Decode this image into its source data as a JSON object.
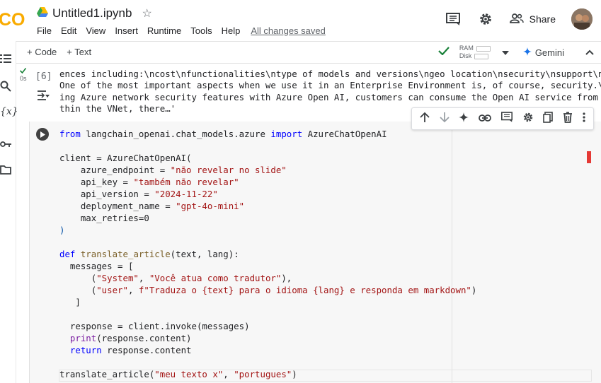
{
  "notebook": {
    "title": "Untitled1.ipynb",
    "logo_text": "CO"
  },
  "menu": {
    "items": [
      "File",
      "Edit",
      "View",
      "Insert",
      "Runtime",
      "Tools",
      "Help"
    ],
    "saved_status": "All changes saved"
  },
  "header": {
    "share_label": "Share"
  },
  "toolbar": {
    "add_code": "+ Code",
    "add_text": "+ Text",
    "ram_label": "RAM",
    "disk_label": "Disk",
    "gemini_label": "Gemini"
  },
  "output_cell": {
    "exec_count": "[6]",
    "time": "0s",
    "lines": [
      "ences including:\\ncost\\nfunctionalities\\ntype of models and versions\\ngeo location\\nsecurity\\nsupport\\netc.\\n",
      "One of the most important aspects when we use it in an Enterprise Environment is, of course, security.\\nBy us",
      "ing Azure network security features with Azure Open AI, customers can consume the Open AI service from and wi",
      "thin the VNet, there…'"
    ]
  },
  "code_cell": {
    "l1": {
      "kw1": "from",
      "mod": " langchain_openai.chat_models.azure ",
      "kw2": "import",
      "cls": " AzureChatOpenAI"
    },
    "l3": "client = AzureChatOpenAI(",
    "l4": {
      "k": "    azure_endpoint = ",
      "v": "\"não revelar no slide\""
    },
    "l5": {
      "k": "    api_key = ",
      "v": "\"também não revelar\""
    },
    "l6": {
      "k": "    api_version = ",
      "v": "\"2024-11-22\""
    },
    "l7": {
      "k": "    deployment_name = ",
      "v": "\"gpt-4o-mini\""
    },
    "l8": "    max_retries=0",
    "l9": ")",
    "l11": {
      "kw": "def",
      "fn": " translate_article",
      "rest": "(text, lang):"
    },
    "l12": "  messages = [",
    "l13": {
      "pre": "      (",
      "s1": "\"System\"",
      "sep": ", ",
      "s2": "\"Você atua como tradutor\"",
      "post": "),"
    },
    "l14": {
      "pre": "      (",
      "s1": "\"user\"",
      "sep": ", ",
      "s2": "f\"Traduza o {text} para o idioma {lang} e responda em markdown\"",
      "post": ")"
    },
    "l15": "   ]",
    "l17": "  response = client.invoke(messages)",
    "l18": {
      "fn": "  print",
      "rest": "(response.content)"
    },
    "l19": {
      "kw": "  return",
      "rest": " response.content"
    },
    "l21": {
      "fn": "translate_article",
      "pre": "(",
      "s1": "\"meu texto x\"",
      "sep": ", ",
      "s2": "\"portugues\"",
      "post": ")"
    }
  },
  "colors": {
    "accent_green": "#188038",
    "keyword_blue": "#0000ff",
    "string_red": "#a31515",
    "gemini_blue": "#1a73e8"
  }
}
